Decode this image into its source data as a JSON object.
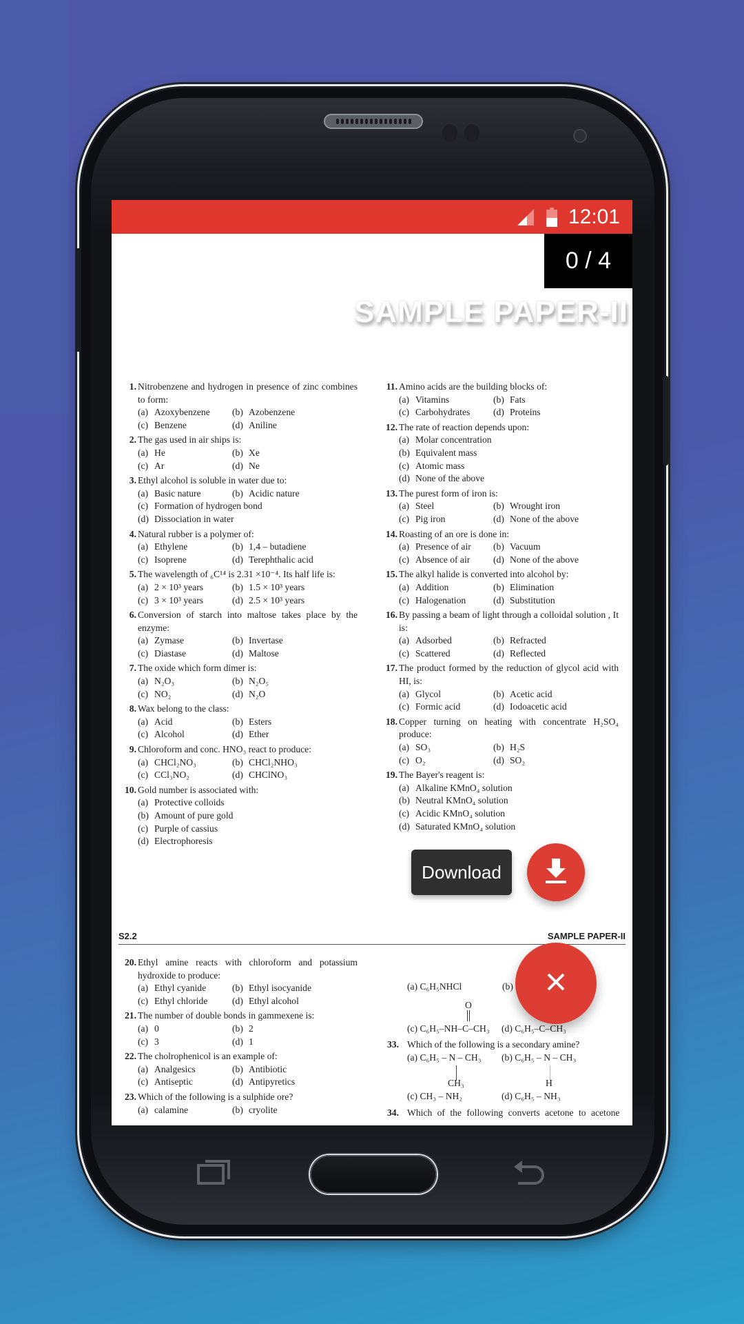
{
  "status_bar": {
    "time": "12:01",
    "signal_icon": "signal-icon",
    "battery_icon": "battery-icon"
  },
  "viewer": {
    "page_counter": "0 / 4",
    "banner_title": "SAMPLE PAPER-II"
  },
  "page1": {
    "left_column": [
      {
        "num": "1.",
        "text": "Nitrobenzene and hydrogen in presence of zinc combines to form:",
        "options": [
          "Azoxybenzene",
          "Azobenzene",
          "Benzene",
          "Aniline"
        ],
        "layout": "two"
      },
      {
        "num": "2.",
        "text": "The gas used in air ships is:",
        "options": [
          "He",
          "Xe",
          "Ar",
          "Ne"
        ],
        "layout": "two"
      },
      {
        "num": "3.",
        "text": "Ethyl alcohol is soluble in water due to:",
        "options": [
          "Basic nature",
          "Acidic nature",
          "Formation of hydrogen bond",
          "Dissociation in water"
        ],
        "layout": "mixed"
      },
      {
        "num": "4.",
        "text": "Natural rubber is a polymer of:",
        "options": [
          "Ethylene",
          "1,4 – butadiene",
          "Isoprene",
          "Terephthalic acid"
        ],
        "layout": "two"
      },
      {
        "num": "5.",
        "text": "The wavelength of ₆C¹⁴ is 2.31 ×10⁻⁴. Its half life is:",
        "options": [
          "2 × 10³ years",
          "1.5 × 10³ years",
          "3 × 10³ years",
          "2.5 × 10³ years"
        ],
        "layout": "two"
      },
      {
        "num": "6.",
        "text": "Conversion of starch into maltose takes place by the enzyme:",
        "options": [
          "Zymase",
          "Invertase",
          "Diastase",
          "Maltose"
        ],
        "layout": "two"
      },
      {
        "num": "7.",
        "text": "The oxide which form dimer is:",
        "options": [
          "N₂O₃",
          "N₂O₅",
          "NO₂",
          "N₂O"
        ],
        "layout": "two"
      },
      {
        "num": "8.",
        "text": "Wax belong to the class:",
        "options": [
          "Acid",
          "Esters",
          "Alcohol",
          "Ether"
        ],
        "layout": "two"
      },
      {
        "num": "9.",
        "text": "Chloroform and conc. HNO₃ react to produce:",
        "options": [
          "CHCl₂NO₃",
          "CHCl₂NHO₃",
          "CCl₃NO₂",
          "CHClNO₃"
        ],
        "layout": "two"
      },
      {
        "num": "10.",
        "text": "Gold number is associated with:",
        "options": [
          "Protective colloids",
          "Amount of pure gold",
          "Purple of cassius",
          "Electrophoresis"
        ],
        "layout": "one"
      }
    ],
    "right_column": [
      {
        "num": "11.",
        "text": "Amino acids are the building blocks of:",
        "options": [
          "Vitamins",
          "Fats",
          "Carbohydrates",
          "Proteins"
        ],
        "layout": "two"
      },
      {
        "num": "12.",
        "text": "The rate of reaction  depends upon:",
        "options": [
          "Molar concentration",
          "Equivalent mass",
          "Atomic mass",
          "None of the above"
        ],
        "layout": "one"
      },
      {
        "num": "13.",
        "text": "The purest form of iron is:",
        "options": [
          "Steel",
          "Wrought iron",
          "Pig iron",
          "None of the above"
        ],
        "layout": "two"
      },
      {
        "num": "14.",
        "text": "Roasting  of an ore is done in:",
        "options": [
          "Presence of air",
          "Vacuum",
          "Absence of air",
          "None of the above"
        ],
        "layout": "two"
      },
      {
        "num": "15.",
        "text": "The alkyl halide is converted into alcohol by:",
        "options": [
          "Addition",
          "Elimination",
          "Halogenation",
          "Substitution"
        ],
        "layout": "two"
      },
      {
        "num": "16.",
        "text": "By passing a beam of light through a colloidal solution , It is:",
        "options": [
          "Adsorbed",
          "Refracted",
          "Scattered",
          "Reflected"
        ],
        "layout": "two"
      },
      {
        "num": "17.",
        "text": "The product formed by the reduction of glycol acid with HI, is:",
        "options": [
          "Glycol",
          "Acetic acid",
          "Formic acid",
          "Iodoacetic acid"
        ],
        "layout": "two"
      },
      {
        "num": "18.",
        "text": "Copper turning on heating with concentrate H₂SO₄ produce:",
        "options": [
          "SO₃",
          "H₂S",
          "O₂",
          "SO₂"
        ],
        "layout": "two"
      },
      {
        "num": "19.",
        "text": "The Bayer's  reagent is:",
        "options": [
          "Alkaline KMnO₄ solution",
          "Neutral KMnO₄ solution",
          "Acidic KMnO₄ solution",
          "Saturated KMnO₄ solution"
        ],
        "layout": "one"
      }
    ]
  },
  "page2": {
    "header_left": "S2.2",
    "header_right": "SAMPLE PAPER-II",
    "left_column": [
      {
        "num": "20.",
        "text": "Ethyl amine reacts with chloroform and potassium hydroxide to produce:",
        "options": [
          "Ethyl cyanide",
          "Ethyl isocyanide",
          "Ethyl chloride",
          "Ethyl alcohol"
        ],
        "layout": "two"
      },
      {
        "num": "21.",
        "text": "The number of double bonds in gammexene is:",
        "options": [
          "0",
          "2",
          "3",
          "1"
        ],
        "layout": "two"
      },
      {
        "num": "22.",
        "text": "The cholrophenicol is an example of:",
        "options": [
          "Analgesics",
          "Antibiotic",
          "Antiseptic",
          "Antipyretics"
        ],
        "layout": "two"
      },
      {
        "num": "23.",
        "text": "Which of the following is a sulphide ore?",
        "options": [
          "calamine",
          "cryolite"
        ],
        "layout": "two"
      }
    ],
    "right_column": {
      "q32_opt_a": "(a)  C₆H₅NHCl",
      "q32_opt_b": "(b)",
      "q32_carbonyl_o": "O",
      "q32_opt_c": "(c)  C₆H₅–NH–C–CH₃",
      "q32_opt_d": "(d)  C₆H₅–C–CH₃",
      "q33_num": "33.",
      "q33_text": "Which of the following is a secondary amine?",
      "q33_opt_a": "(a)  C₆H₅ – N – CH₃",
      "q33_opt_b": "(b)  C₆H₅ – N – CH₃",
      "q33_sub_a": "CH₃",
      "q33_sub_b": "H",
      "q33_opt_c": "(c)  CH₃ – NH₂",
      "q33_opt_d": "(d)  C₆H₅ – NH₃",
      "q34_num": "34.",
      "q34_text": "Which of the following converts acetone to acetone"
    }
  },
  "actions": {
    "download_label": "Download",
    "download_icon": "download-icon",
    "close_icon": "close-icon"
  },
  "navigation": {
    "recent_icon": "recent-apps-icon",
    "home": "home-button",
    "back_icon": "back-icon"
  },
  "colors": {
    "accent": "#df372d",
    "fab": "#dd3d32",
    "label_bg": "#2f2f2f"
  }
}
